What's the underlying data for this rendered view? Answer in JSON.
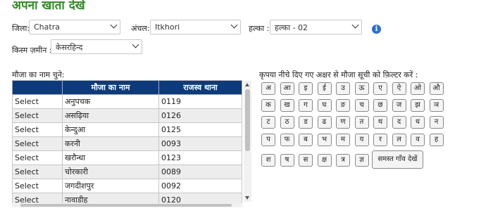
{
  "page_title": "अपना खाता देखें",
  "filters": {
    "district": {
      "label": "जिला:",
      "value": "Chatra"
    },
    "block": {
      "label": "अंचल:",
      "value": "Itkhori"
    },
    "halka": {
      "label": "हल्का :",
      "value": "हल्का - 02"
    },
    "land_type": {
      "label": "किस्म ज़मीन :",
      "value": "केसरहिन्द"
    },
    "info_icon": "i"
  },
  "village_section": {
    "label": "मौजा का नाम चुने:",
    "columns": [
      "",
      "मौजा का नाम",
      "राजस्व थाना"
    ],
    "rows": [
      {
        "action": "Select",
        "name": "अनुपचक",
        "thana": "0119"
      },
      {
        "action": "Select",
        "name": "असढ़िया",
        "thana": "0126"
      },
      {
        "action": "Select",
        "name": "केन्दुआ",
        "thana": "0125"
      },
      {
        "action": "Select",
        "name": "करनी",
        "thana": "0093"
      },
      {
        "action": "Select",
        "name": "खरौन्धा",
        "thana": "0123"
      },
      {
        "action": "Select",
        "name": "चोरकारी",
        "thana": "0089"
      },
      {
        "action": "Select",
        "name": "जगदीशपुर",
        "thana": "0092"
      },
      {
        "action": "Select",
        "name": "नावाडीह",
        "thana": "0120"
      }
    ]
  },
  "alphabet_filter": {
    "label": "कृपया नीचे दिए गए अक्षर से मौजा सूची को फ़िल्टर करें :",
    "rows": [
      [
        "अ",
        "आ",
        "इ",
        "ई",
        "उ",
        "ऊ",
        "ए",
        "ऐ",
        "ओ",
        "औ"
      ],
      [
        "क",
        "ख",
        "ग",
        "घ",
        "ङ",
        "च",
        "छ",
        "ज",
        "झ",
        "ञ"
      ],
      [
        "ट",
        "ठ",
        "ड",
        "ढ",
        "ण",
        "त",
        "थ",
        "द",
        "ध",
        "न"
      ],
      [
        "प",
        "फ",
        "ब",
        "भ",
        "म",
        "य",
        "र",
        "ल",
        "व",
        "ह"
      ],
      [
        "श",
        "ष",
        "स",
        "क्ष",
        "त्र",
        "ज्ञ"
      ]
    ],
    "show_all_label": "समस्त गाँव देखें"
  },
  "colors": {
    "title": "#2e8a22",
    "table_header": "#0d3b7a",
    "info_icon": "#2b6fd6"
  }
}
